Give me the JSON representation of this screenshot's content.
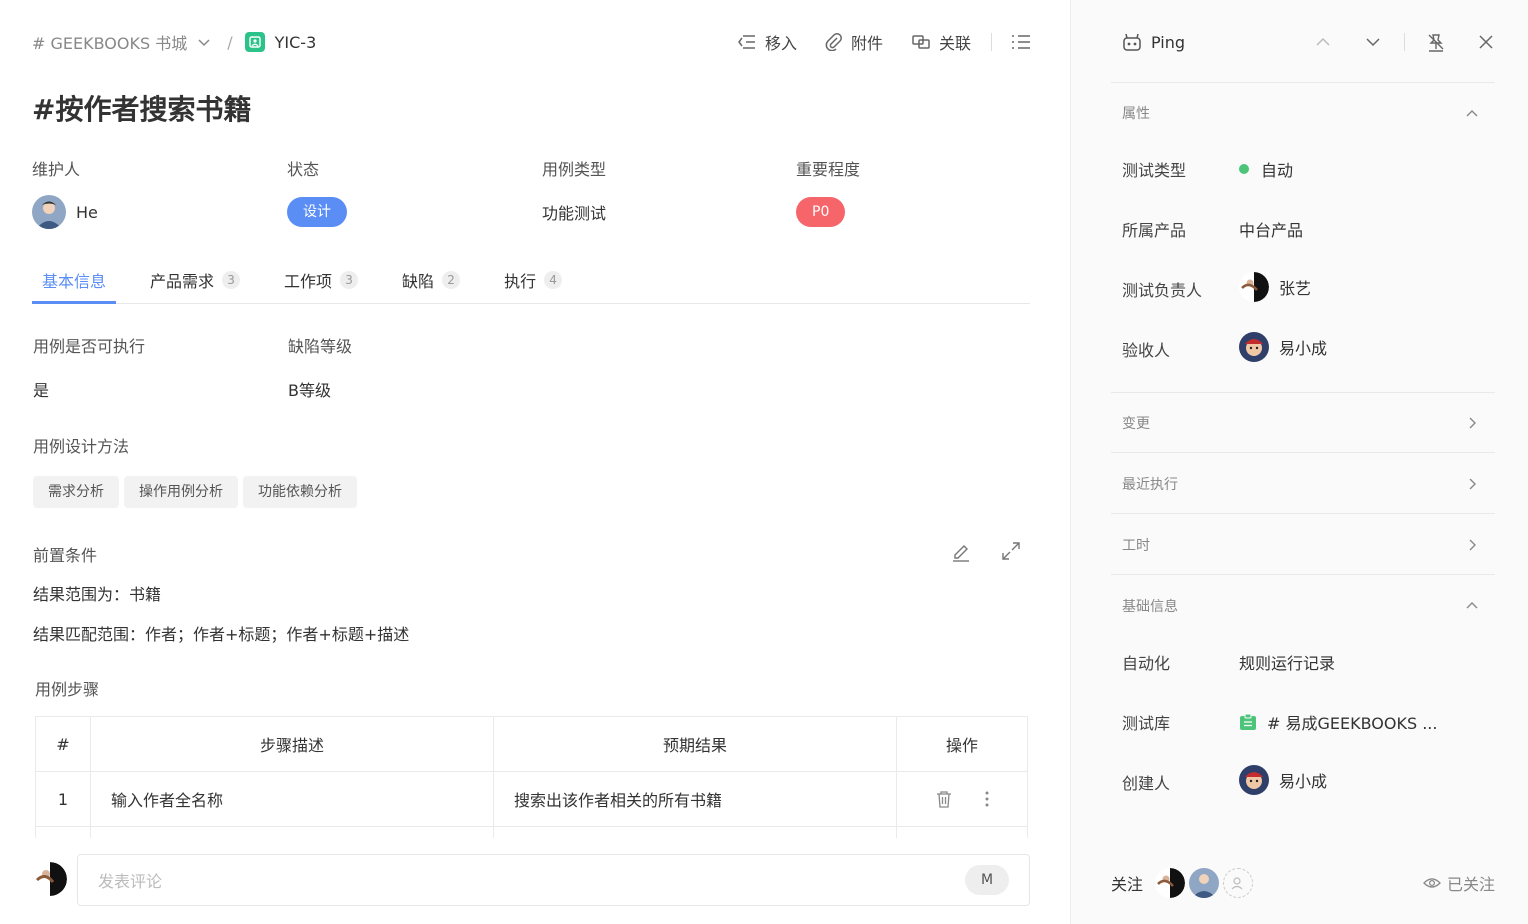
{
  "breadcrumb": {
    "project": "# GEEKBOOKS 书城",
    "separator": "/",
    "code": "YIC-3"
  },
  "toolbar": {
    "move_label": "移入",
    "attach_label": "附件",
    "link_label": "关联"
  },
  "title": "#按作者搜索书籍",
  "props": {
    "maintainer_label": "维护人",
    "maintainer_value": "He",
    "status_label": "状态",
    "status_value": "设计",
    "type_label": "用例类型",
    "type_value": "功能测试",
    "priority_label": "重要程度",
    "priority_value": "P0"
  },
  "colors": {
    "accent": "#5b8ef4",
    "priority": "#f5656a",
    "green": "#2cc38a"
  },
  "tabs": [
    {
      "label": "基本信息",
      "count": ""
    },
    {
      "label": "产品需求",
      "count": "3"
    },
    {
      "label": "工作项",
      "count": "3"
    },
    {
      "label": "缺陷",
      "count": "2"
    },
    {
      "label": "执行",
      "count": "4"
    }
  ],
  "basic": {
    "executable_label": "用例是否可执行",
    "executable_value": "是",
    "defect_level_label": "缺陷等级",
    "defect_level_value": "B等级",
    "design_method_label": "用例设计方法",
    "methods": [
      "需求分析",
      "操作用例分析",
      "功能依赖分析"
    ],
    "precondition_label": "前置条件",
    "precondition_lines": [
      "结果范围为：书籍",
      "结果匹配范围：作者；作者+标题；作者+标题+描述"
    ],
    "steps_label": "用例步骤"
  },
  "steps": {
    "headers": [
      "#",
      "步骤描述",
      "预期结果",
      "操作"
    ],
    "rows": [
      {
        "no": "1",
        "desc": "输入作者全名称",
        "expected": "搜索出该作者相关的所有书籍"
      }
    ]
  },
  "comment": {
    "placeholder": "发表评论",
    "mention": "M"
  },
  "side": {
    "title": "Ping",
    "attributes_label": "属性",
    "test_type_label": "测试类型",
    "test_type_value": "自动",
    "product_label": "所属产品",
    "product_value": "中台产品",
    "owner_label": "测试负责人",
    "owner_value": "张艺",
    "acceptor_label": "验收人",
    "acceptor_value": "易小成",
    "changes_label": "变更",
    "recent_label": "最近执行",
    "hours_label": "工时",
    "base_label": "基础信息",
    "automation_label": "自动化",
    "automation_value": "规则运行记录",
    "library_label": "测试库",
    "library_value": "# 易成GEEKBOOKS ...",
    "creator_label": "创建人",
    "creator_value": "易小成",
    "follow_label": "关注",
    "followed_label": "已关注"
  }
}
